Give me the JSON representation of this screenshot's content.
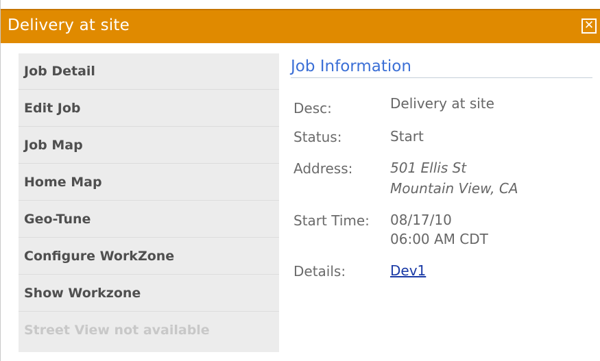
{
  "dialog": {
    "title": "Delivery at site",
    "close_glyph": "✕",
    "accent_color": "#e08a00"
  },
  "menu": {
    "items": [
      {
        "label": "Job Detail",
        "enabled": true
      },
      {
        "label": "Edit Job",
        "enabled": true
      },
      {
        "label": "Job Map",
        "enabled": true
      },
      {
        "label": "Home Map",
        "enabled": true
      },
      {
        "label": "Geo-Tune",
        "enabled": true
      },
      {
        "label": "Configure WorkZone",
        "enabled": true
      },
      {
        "label": "Show Workzone",
        "enabled": true
      },
      {
        "label": "Street View not available",
        "enabled": false
      }
    ]
  },
  "job_info": {
    "heading": "Job Information",
    "desc_label": "Desc:",
    "desc_value": "Delivery at site",
    "status_label": "Status:",
    "status_value": "Start",
    "address_label": "Address:",
    "address_line1": "501 Ellis St",
    "address_line2": "Mountain View, CA",
    "start_label": "Start Time:",
    "start_date": "08/17/10",
    "start_time": "06:00 AM CDT",
    "details_label": "Details:",
    "details_link": "Dev1"
  }
}
